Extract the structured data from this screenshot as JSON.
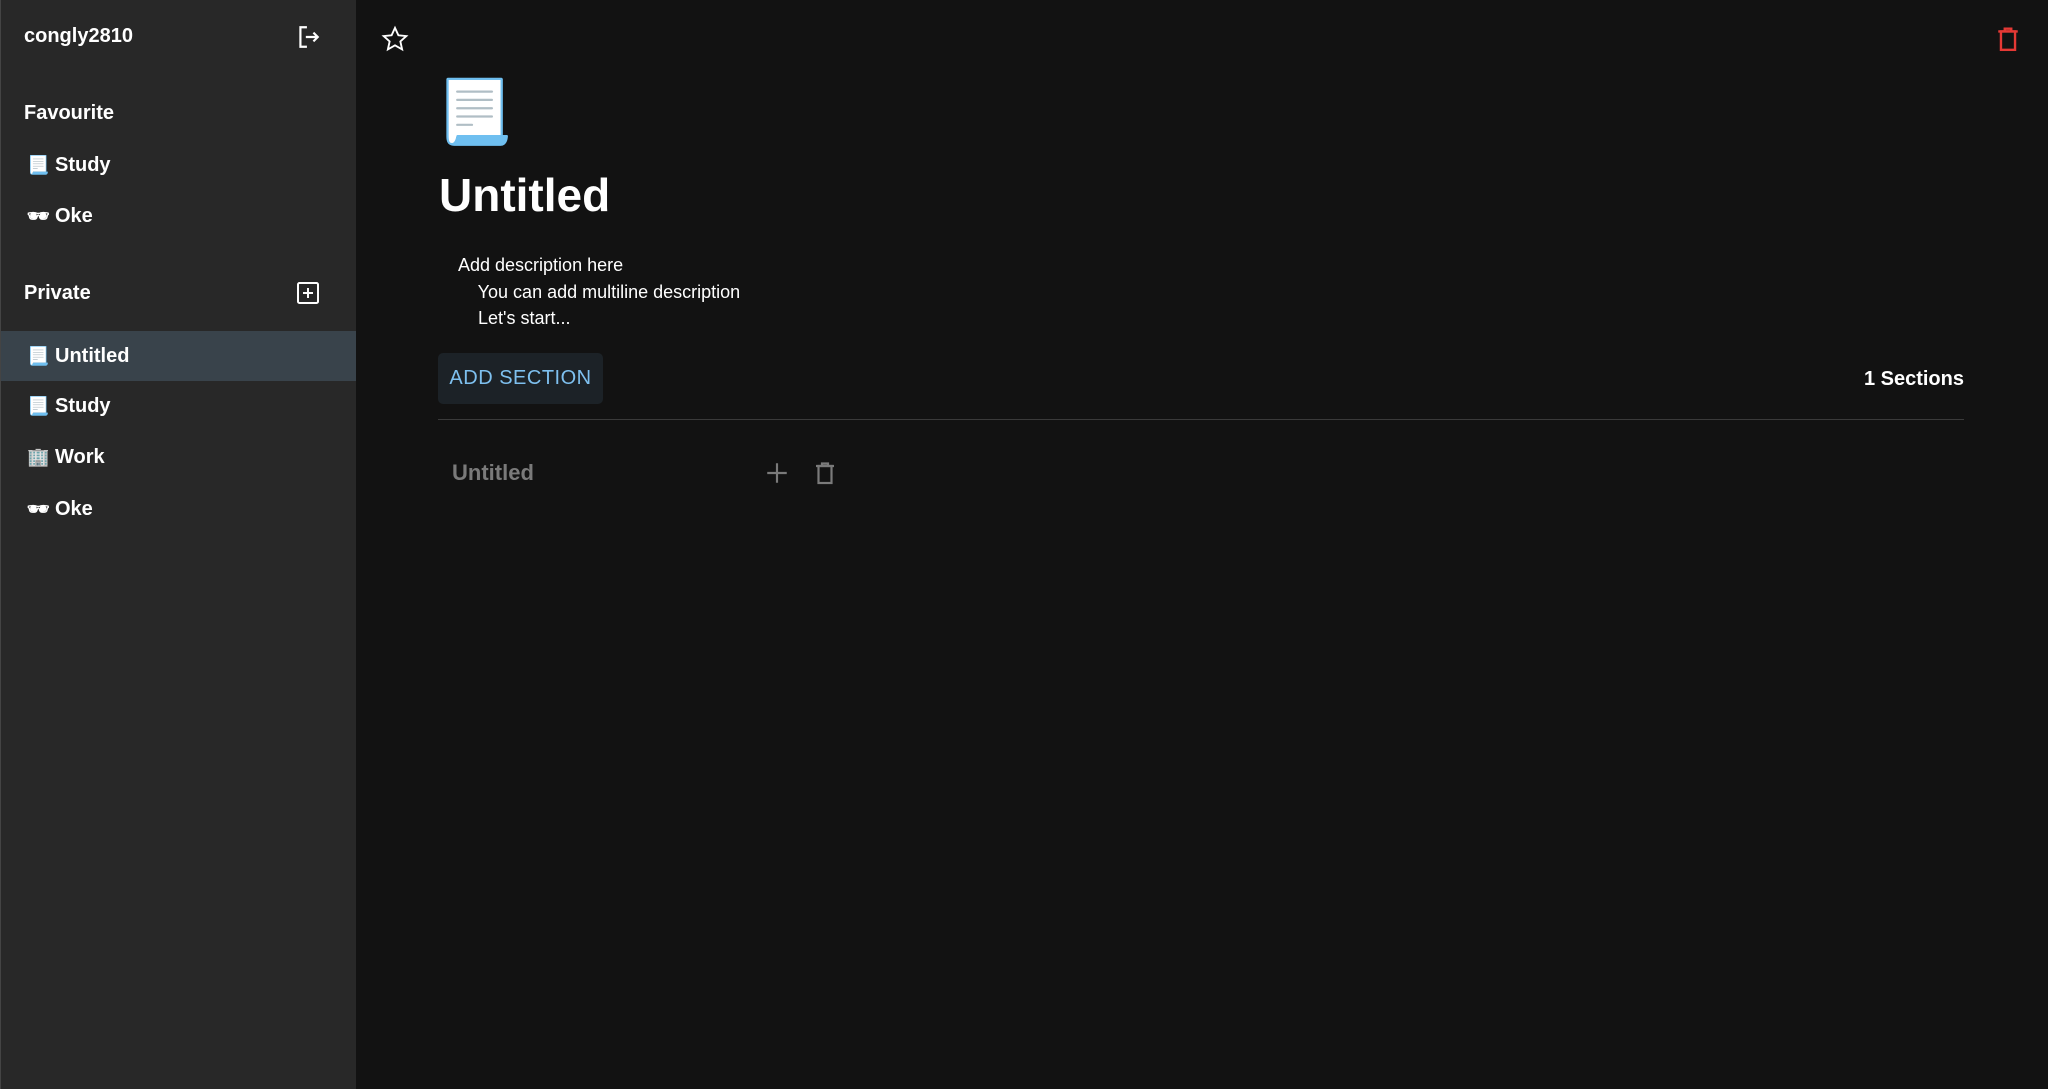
{
  "sidebar": {
    "username": "congly2810",
    "favourite": {
      "title": "Favourite",
      "items": [
        {
          "icon": "📃",
          "label": "Study"
        },
        {
          "icon": "🕶",
          "label": "Oke"
        }
      ]
    },
    "private": {
      "title": "Private",
      "items": [
        {
          "icon": "📃",
          "label": "Untitled",
          "active": true
        },
        {
          "icon": "📃",
          "label": "Study"
        },
        {
          "icon": "🏢",
          "label": "Work"
        },
        {
          "icon": "🕶",
          "label": "Oke"
        }
      ]
    }
  },
  "page": {
    "icon": "📃",
    "title": "Untitled",
    "description": "Add description here\n    You can add multiline description\n    Let's start...",
    "add_section_label": "ADD SECTION",
    "sections_count": "1 Sections",
    "sections": [
      {
        "title": "Untitled"
      }
    ]
  },
  "colors": {
    "accent": "#7ec0ef",
    "danger": "#e53935",
    "active_item": "#39434b"
  }
}
